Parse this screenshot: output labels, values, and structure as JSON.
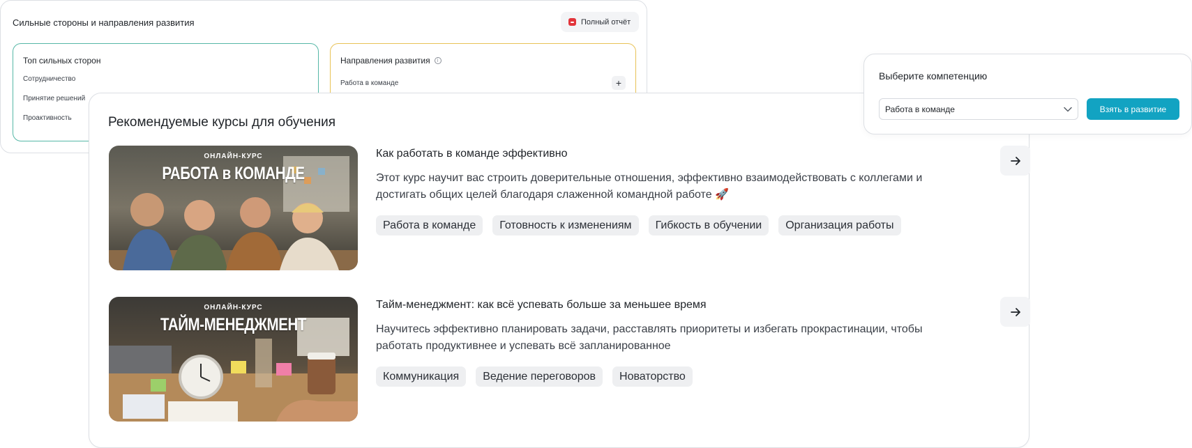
{
  "strengths_card": {
    "title": "Сильные стороны и направления развития",
    "report_button": "Полный отчёт",
    "top_strengths": {
      "title": "Топ сильных сторон",
      "items": [
        "Сотрудничество",
        "Принятие решений",
        "Проактивность"
      ]
    },
    "development": {
      "title": "Направления развития",
      "items": [
        "Работа в команде"
      ]
    }
  },
  "courses_card": {
    "title": "Рекомендуемые курсы для обучения",
    "courses": [
      {
        "image_kicker": "ОНЛАЙН-КУРС",
        "image_title": "РАБОТА в КОМАНДЕ",
        "title": "Как работать в команде эффективно",
        "description": "Этот курс научит вас строить доверительные отношения, эффективно взаимодействовать с коллегами и достигать общих целей благодаря слаженной командной работе 🚀",
        "tags": [
          "Работа в команде",
          "Готовность к изменениям",
          "Гибкость в обучении",
          "Организация работы"
        ]
      },
      {
        "image_kicker": "ОНЛАЙН-КУРС",
        "image_title": "ТАЙМ-МЕНЕДЖМЕНТ",
        "title": "Тайм-менеджмент: как всё успевать больше за меньшее время",
        "description": "Научитесь эффективно планировать задачи, расставлять приоритеты и избегать прокрастинации, чтобы работать продуктивнее и успевать всё запланированное",
        "tags": [
          "Коммуникация",
          "Ведение переговоров",
          "Новаторство"
        ]
      }
    ]
  },
  "competence_popover": {
    "title": "Выберите компетенцию",
    "selected": "Работа в команде",
    "button": "Взять в развитие"
  },
  "colors": {
    "accent": "#12a3c2",
    "strengths_border": "#55b7a6",
    "development_border": "#e8c255",
    "pdf_red": "#e2353b"
  }
}
